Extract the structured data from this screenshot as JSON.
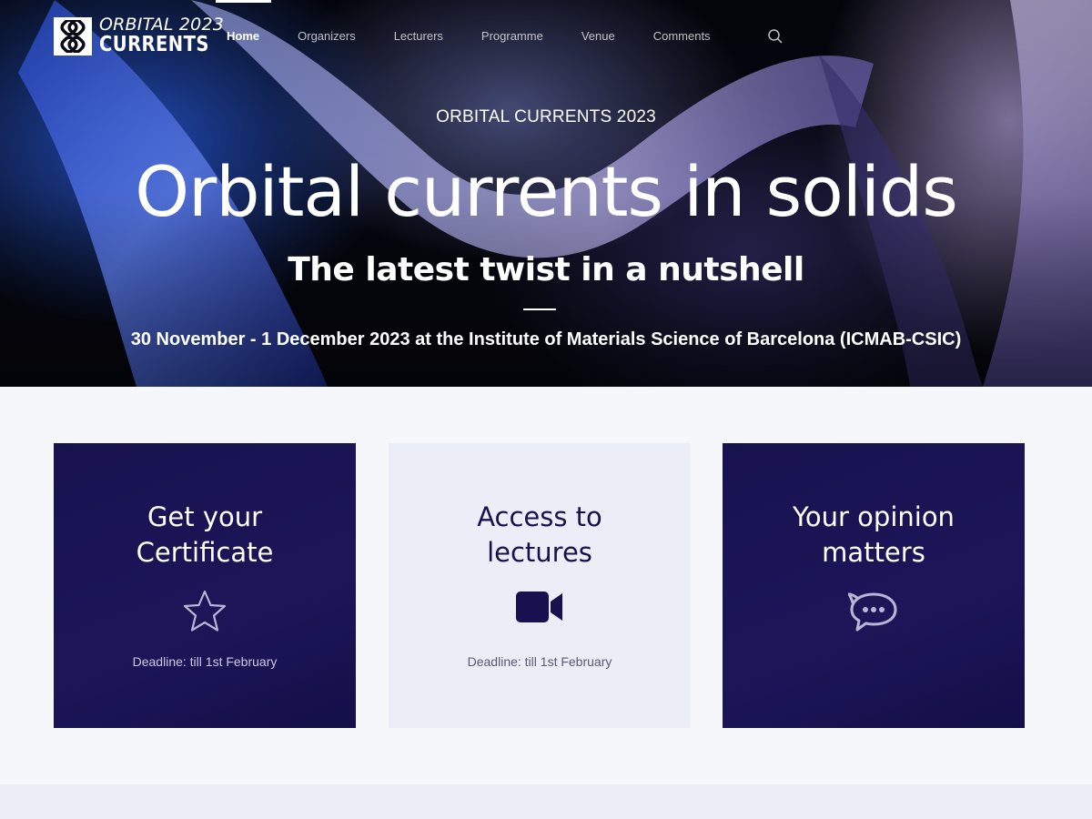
{
  "brand": {
    "line1": "ORBITAL 2023",
    "line2": "CURRENTS",
    "logo_icon": "interlocking-loops-logo"
  },
  "nav": {
    "items": [
      {
        "label": "Home",
        "active": true
      },
      {
        "label": "Organizers"
      },
      {
        "label": "Lecturers"
      },
      {
        "label": "Programme"
      },
      {
        "label": "Venue"
      },
      {
        "label": "Comments"
      }
    ],
    "search_icon": "search-icon"
  },
  "hero": {
    "kicker": "ORBITAL CURRENTS 2023",
    "title": "Orbital currents in solids",
    "subtitle": "The latest twist in a nutshell",
    "dates": "30 November - 1 December 2023 at the Institute of Materials Science of Barcelona (ICMAB-CSIC)"
  },
  "cards": [
    {
      "title": "Get your Certificate",
      "icon": "star-outline-icon",
      "note": "Deadline: till 1st February"
    },
    {
      "title": "Access to lectures",
      "icon": "video-camera-icon",
      "note": "Deadline: till 1st February"
    },
    {
      "title": "Your opinion matters",
      "icon": "chat-bubble-icon",
      "note": ""
    }
  ],
  "colors": {
    "navy": "#17124f",
    "light_card": "#ebeef6",
    "page_bg": "#f5f7fb",
    "white": "#ffffff"
  }
}
